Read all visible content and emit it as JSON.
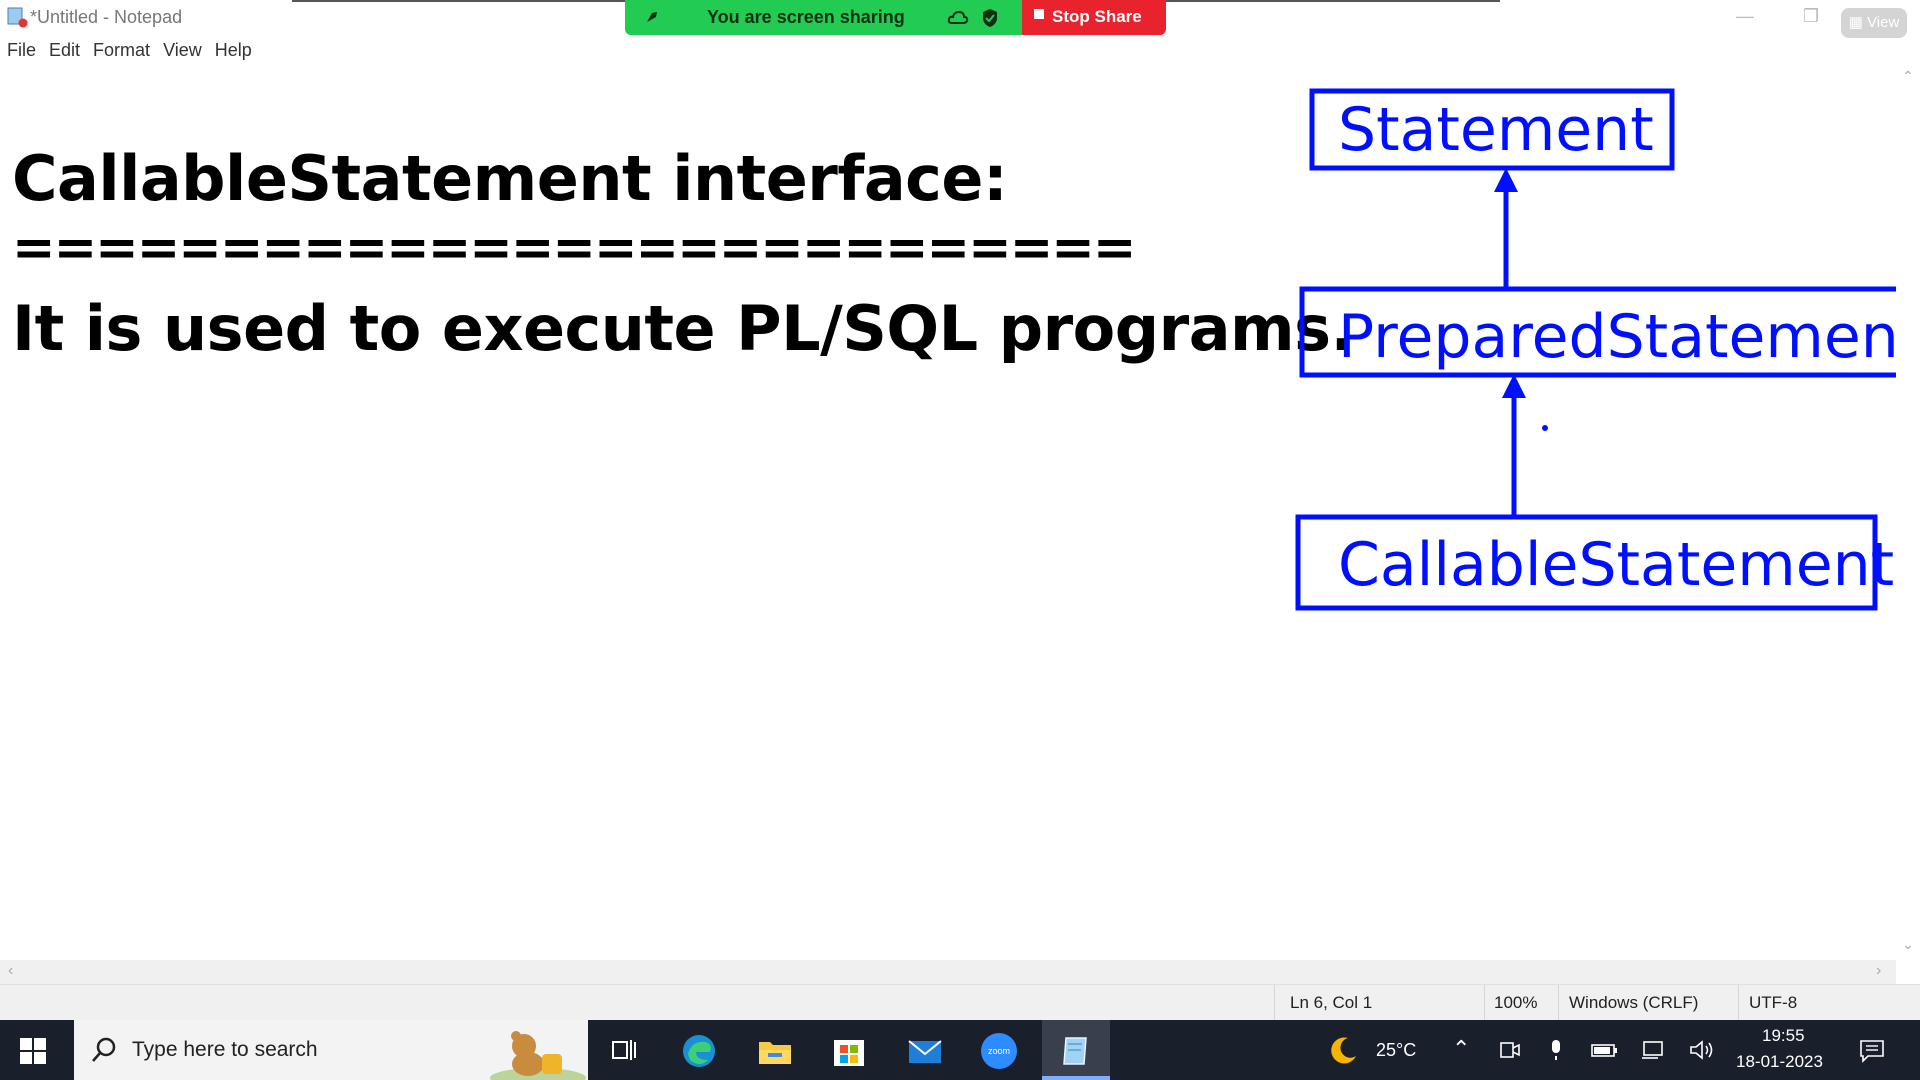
{
  "window": {
    "title": "*Untitled - Notepad",
    "view_label": "View"
  },
  "share_bar": {
    "status": "You are screen sharing",
    "stop_label": "Stop Share",
    "colors": {
      "green": "#22cb52",
      "red": "#e8232e"
    }
  },
  "menu": {
    "items": [
      "File",
      "Edit",
      "Format",
      "View",
      "Help"
    ]
  },
  "editor": {
    "lines": [
      "CallableStatement interface:",
      "===========================",
      "It is used to execute PL/SQL programs."
    ]
  },
  "diagram": {
    "color": "#0010ff",
    "boxes": [
      "Statement",
      "PreparedStatement",
      "CallableStatement"
    ]
  },
  "status_bar": {
    "position": "Ln 6, Col 1",
    "zoom": "100%",
    "line_ending": "Windows (CRLF)",
    "encoding": "UTF-8"
  },
  "taskbar": {
    "search_placeholder": "Type here to search",
    "apps": [
      "task-view-icon",
      "edge-icon",
      "file-explorer-icon",
      "store-icon",
      "mail-icon",
      "zoom-icon",
      "notepad-icon"
    ],
    "weather": "25°C",
    "time": "19:55",
    "date": "18-01-2023"
  }
}
